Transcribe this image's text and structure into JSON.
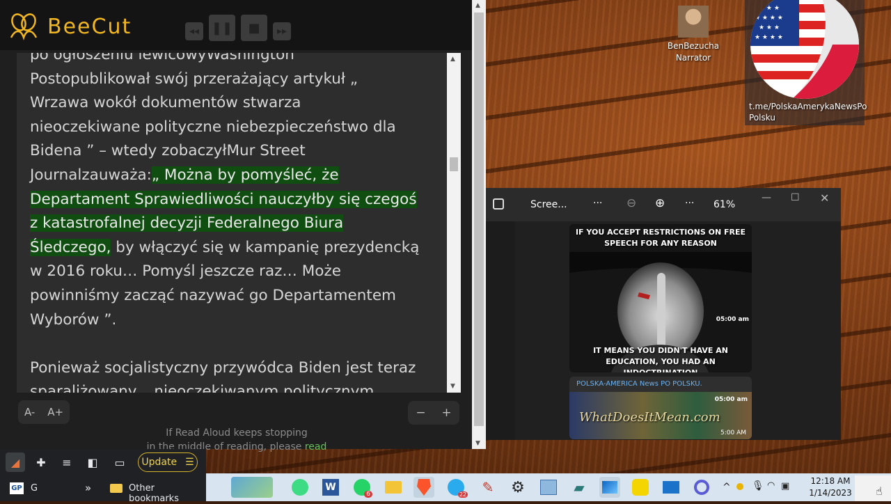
{
  "app": {
    "name": "BeeCut"
  },
  "reader": {
    "lines": [
      "po ogłoszeniu lewicowyWashington",
      "Postopublikował swój przerażający artykuł „",
      "Wrzawa wokół dokumentów stwarza",
      "nieoczekiwane polityczne niebezpieczeństwo dla",
      "Bidena ” – wtedy zobaczyłMur Street",
      "Journalzauważa:",
      "„ Można by pomyśleć, że",
      "Departament Sprawiedliwości nauczyłby się czegoś",
      "z katastrofalnej decyzji Federalnego Biura",
      "Śledczego,",
      " by włączyć się w kampanię prezydencką",
      "w 2016 roku… Pomyśl jeszcze raz… Może",
      "powinniśmy zacząć nazywać go Departamentem",
      "Wyborów ”.",
      "Ponieważ socjalistyczny przywódca Biden jest teraz",
      "sparaliżowany „ nieoczekiwanym politycznym"
    ],
    "font_decrease": "A-",
    "font_increase": "A+",
    "speed_minus": "−",
    "speed_plus": "+",
    "notice_line1": "If Read Aloud keeps stopping",
    "notice_line2": "in the middle of reading, please ",
    "notice_link": "read"
  },
  "browser": {
    "update_label": "Update",
    "update_icon": "☰",
    "bookmark_g": "G",
    "bookmark_more": "»",
    "other_bookmarks": "Other bookmarks",
    "gp_label": "GP"
  },
  "desktop": {
    "narrator_line1": "BenBezucha",
    "narrator_line2": "Narrator",
    "flag_caption": "t.me/PolskaAmerykaNewsPo Polsku"
  },
  "photos": {
    "title": "Scree...",
    "more1": "···",
    "more2": "···",
    "zoom": "61%",
    "meme_top": "IF YOU ACCEPT RESTRICTIONS ON FREE SPEECH FOR ANY REASON",
    "meme_bottom": "IT MEANS YOU DIDN'T HAVE AN EDUCATION, YOU HAD AN INDOCTRINATION",
    "meme_time": "05:00 am",
    "channel_name": "POLSKA-AMERICA News PO POLSKU.",
    "channel_time": "05:00 am",
    "channel_banner": "WhatDoesItMean.com",
    "channel_time2": "5:00 AM"
  },
  "taskbar": {
    "whatsapp_badge": "6",
    "telegram_badge": "22",
    "time": "12:18 AM",
    "date": "1/14/2023",
    "chevron": "^"
  },
  "colors": {
    "highlight": "#104d10",
    "beecut_yellow": "#f2b71f",
    "update_yellow": "#f1d44a"
  }
}
